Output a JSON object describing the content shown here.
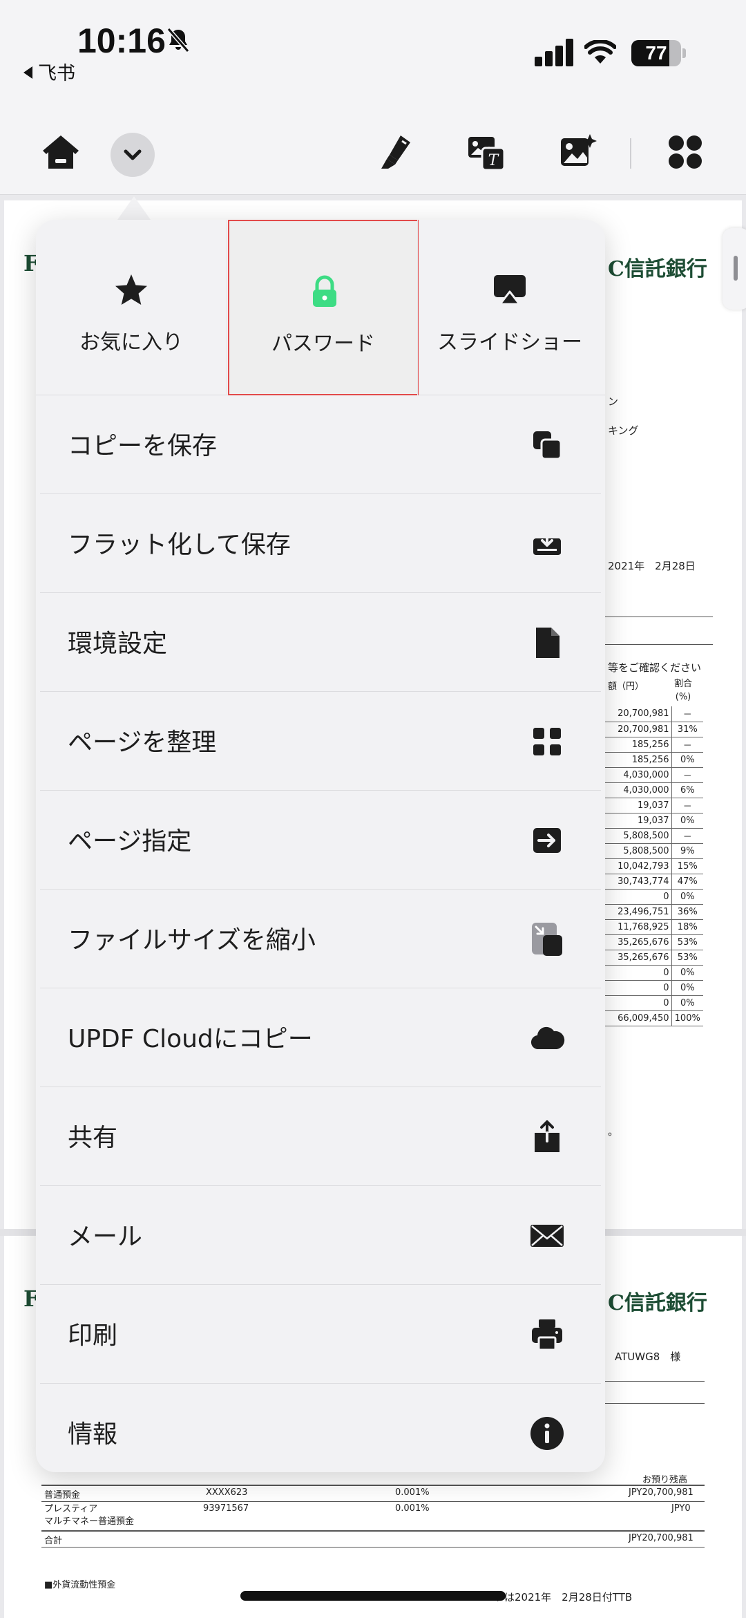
{
  "status_bar": {
    "time": "10:16",
    "back_app": "飞书",
    "battery": "77",
    "battery_level": 0.77
  },
  "toolbar": {
    "icons": [
      "home-icon",
      "chevron-down-icon",
      "highlighter-icon",
      "image-text-icon",
      "ai-image-icon",
      "apps-grid-icon"
    ]
  },
  "document": {
    "bank_name_1": "C信託銀行",
    "bank_name_2": "C信託銀行",
    "left_letter": "F",
    "fragments": {
      "f1": "ン",
      "f2": "キング",
      "date": "2021年　2月28日",
      "confirm": "等をご確認ください",
      "col_amount": "額（円）",
      "col_ratio": "割合\n(%)",
      "addressee": "ATUWG8　様",
      "period": "。"
    },
    "values": [
      [
        "20,700,981",
        "－"
      ],
      [
        "20,700,981",
        "31%"
      ],
      [
        "185,256",
        "－"
      ],
      [
        "185,256",
        "0%"
      ],
      [
        "4,030,000",
        "－"
      ],
      [
        "4,030,000",
        "6%"
      ],
      [
        "19,037",
        "－"
      ],
      [
        "19,037",
        "0%"
      ],
      [
        "5,808,500",
        "－"
      ],
      [
        "5,808,500",
        "9%"
      ],
      [
        "10,042,793",
        "15%"
      ],
      [
        "30,743,774",
        "47%"
      ],
      [
        "0",
        "0%"
      ],
      [
        "23,496,751",
        "36%"
      ],
      [
        "11,768,925",
        "18%"
      ],
      [
        "35,265,676",
        "53%"
      ],
      [
        "35,265,676",
        "53%"
      ],
      [
        "0",
        "0%"
      ],
      [
        "0",
        "0%"
      ],
      [
        "0",
        "0%"
      ],
      [
        "66,009,450",
        "100%"
      ]
    ],
    "bottom_table": {
      "header_right": "お預り残高",
      "rows": [
        {
          "type": "普通預金",
          "number": "XXXX623",
          "rate": "0.001%",
          "balance": "JPY20,700,981"
        },
        {
          "type": "プレスティア\nマルチマネー普通預金",
          "number": "93971567",
          "rate": "0.001%",
          "balance": "JPY0"
        },
        {
          "type": "合計",
          "number": "",
          "rate": "",
          "balance": "JPY20,700,981"
        }
      ],
      "section": "■外貨流動性預金",
      "footer": "ートは2021年　2月28日付TTB"
    }
  },
  "menu": {
    "top_actions": [
      {
        "label": "お気に入り",
        "icon": "star-icon"
      },
      {
        "label": "パスワード",
        "icon": "lock-icon",
        "selected": true
      },
      {
        "label": "スライドショー",
        "icon": "airplay-icon"
      }
    ],
    "items": [
      {
        "label": "コピーを保存",
        "icon": "copy-icon"
      },
      {
        "label": "フラット化して保存",
        "icon": "tray-download-icon"
      },
      {
        "label": "環境設定",
        "icon": "document-icon"
      },
      {
        "label": "ページを整理",
        "icon": "grid-icon"
      },
      {
        "label": "ページ指定",
        "icon": "arrow-right-box-icon"
      },
      {
        "label": "ファイルサイズを縮小",
        "icon": "compress-icon"
      },
      {
        "label": "UPDF Cloudにコピー",
        "icon": "cloud-icon"
      },
      {
        "label": "共有",
        "icon": "share-icon"
      },
      {
        "label": "メール",
        "icon": "mail-icon"
      },
      {
        "label": "印刷",
        "icon": "printer-icon"
      },
      {
        "label": "情報",
        "icon": "info-icon"
      }
    ]
  },
  "colors": {
    "accent_green": "#3ddc84",
    "selection_border": "#e24a4a",
    "bank_green": "#1d4d34"
  }
}
